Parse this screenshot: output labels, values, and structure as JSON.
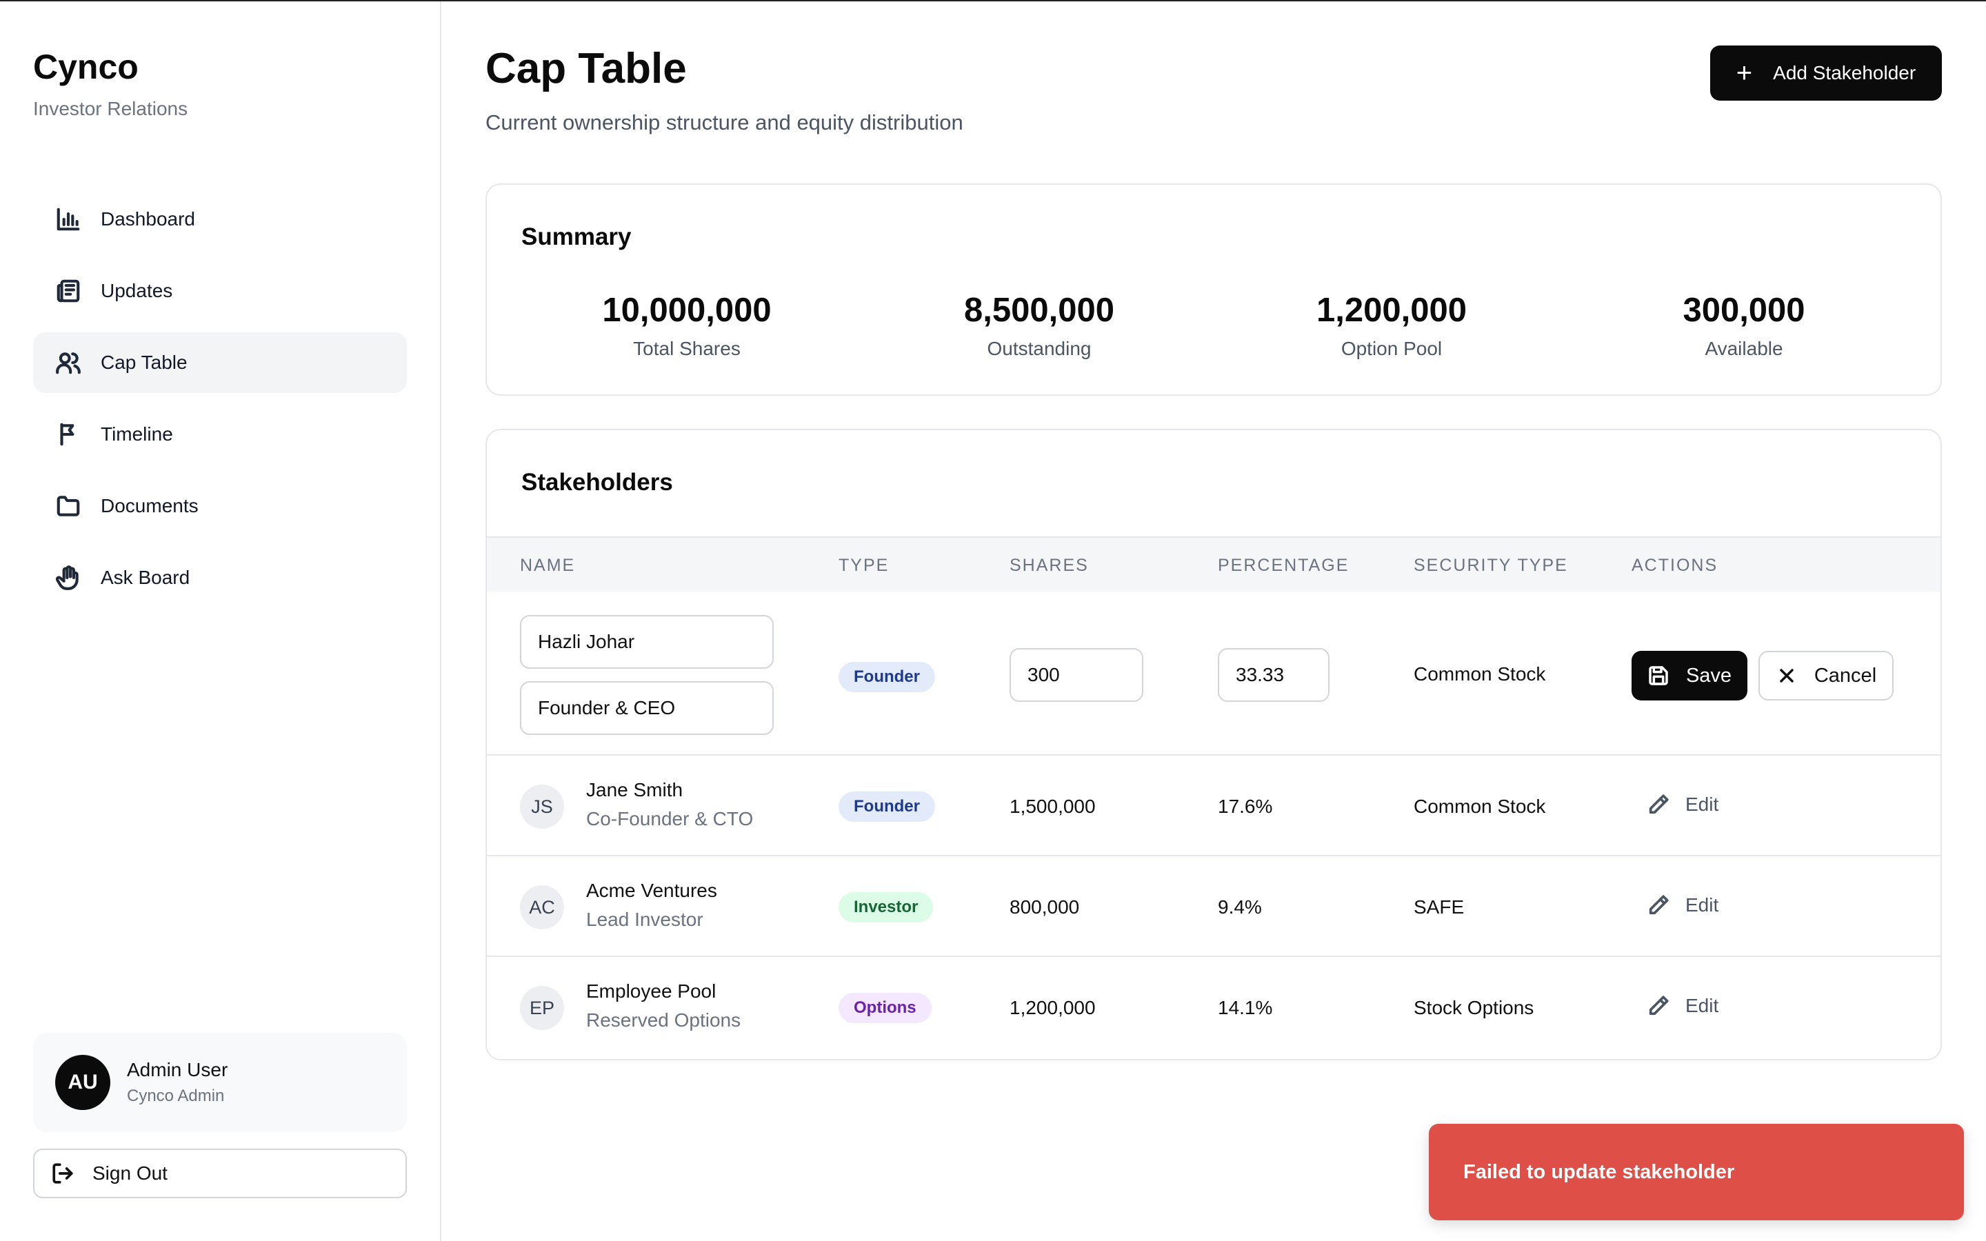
{
  "app": {
    "name": "Cynco",
    "subtitle": "Investor Relations"
  },
  "sidebar": {
    "items": [
      {
        "label": "Dashboard",
        "icon": "bar-chart-icon",
        "active": false
      },
      {
        "label": "Updates",
        "icon": "newspaper-icon",
        "active": false
      },
      {
        "label": "Cap Table",
        "icon": "users-icon",
        "active": true
      },
      {
        "label": "Timeline",
        "icon": "flag-icon",
        "active": false
      },
      {
        "label": "Documents",
        "icon": "folder-icon",
        "active": false
      },
      {
        "label": "Ask Board",
        "icon": "hand-icon",
        "active": false
      }
    ],
    "user": {
      "initials": "AU",
      "name": "Admin User",
      "role": "Cynco Admin"
    },
    "sign_out_label": "Sign Out"
  },
  "header": {
    "title": "Cap Table",
    "subtitle": "Current ownership structure and equity distribution",
    "add_button_label": "Add Stakeholder"
  },
  "summary": {
    "title": "Summary",
    "stats": [
      {
        "value": "10,000,000",
        "label": "Total Shares"
      },
      {
        "value": "8,500,000",
        "label": "Outstanding"
      },
      {
        "value": "1,200,000",
        "label": "Option Pool"
      },
      {
        "value": "300,000",
        "label": "Available"
      }
    ]
  },
  "stakeholders": {
    "title": "Stakeholders",
    "columns": [
      "NAME",
      "TYPE",
      "SHARES",
      "PERCENTAGE",
      "SECURITY TYPE",
      "ACTIONS"
    ],
    "editing_row": {
      "name_value": "Hazli Johar",
      "title_value": "Founder & CEO",
      "type": "Founder",
      "shares_value": "300",
      "percentage_value": "33.33",
      "security_type": "Common Stock",
      "save_label": "Save",
      "cancel_label": "Cancel"
    },
    "rows": [
      {
        "initials": "JS",
        "name": "Jane Smith",
        "title": "Co-Founder & CTO",
        "type": "Founder",
        "shares": "1,500,000",
        "percentage": "17.6%",
        "security_type": "Common Stock",
        "action": "Edit"
      },
      {
        "initials": "AC",
        "name": "Acme Ventures",
        "title": "Lead Investor",
        "type": "Investor",
        "shares": "800,000",
        "percentage": "9.4%",
        "security_type": "SAFE",
        "action": "Edit"
      },
      {
        "initials": "EP",
        "name": "Employee Pool",
        "title": "Reserved Options",
        "type": "Options",
        "shares": "1,200,000",
        "percentage": "14.1%",
        "security_type": "Stock Options",
        "action": "Edit"
      }
    ]
  },
  "toast": {
    "message": "Failed to update stakeholder",
    "color": "#de4f47"
  }
}
